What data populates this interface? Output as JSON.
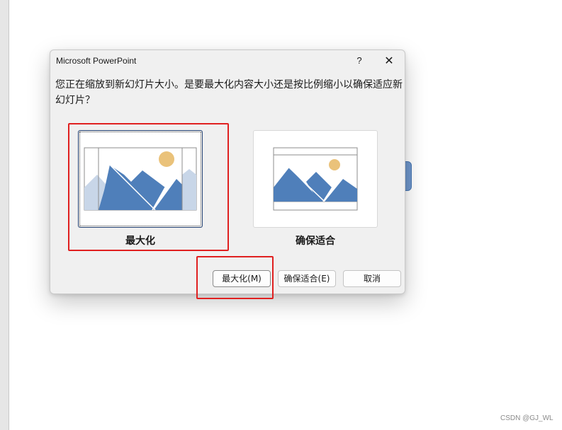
{
  "dialog": {
    "title": "Microsoft PowerPoint",
    "help_label": "?",
    "close_label": "✕",
    "message": "您正在缩放到新幻灯片大小。是要最大化内容大小还是按比例缩小以确保适应新幻灯片？",
    "options": [
      {
        "label": "最大化",
        "icon": "maximize-illustration",
        "selected": true
      },
      {
        "label": "确保适合",
        "icon": "ensure-fit-illustration",
        "selected": false
      }
    ],
    "buttons": {
      "maximize": "最大化(M)",
      "ensure_fit": "确保适合(E)",
      "cancel": "取消"
    }
  },
  "colors": {
    "highlight": "#e02020",
    "mountain": "#4f7fba",
    "mountain_faded": "#c8d6e8",
    "sun": "#eac27a"
  },
  "watermark": "CSDN @GJ_WL"
}
